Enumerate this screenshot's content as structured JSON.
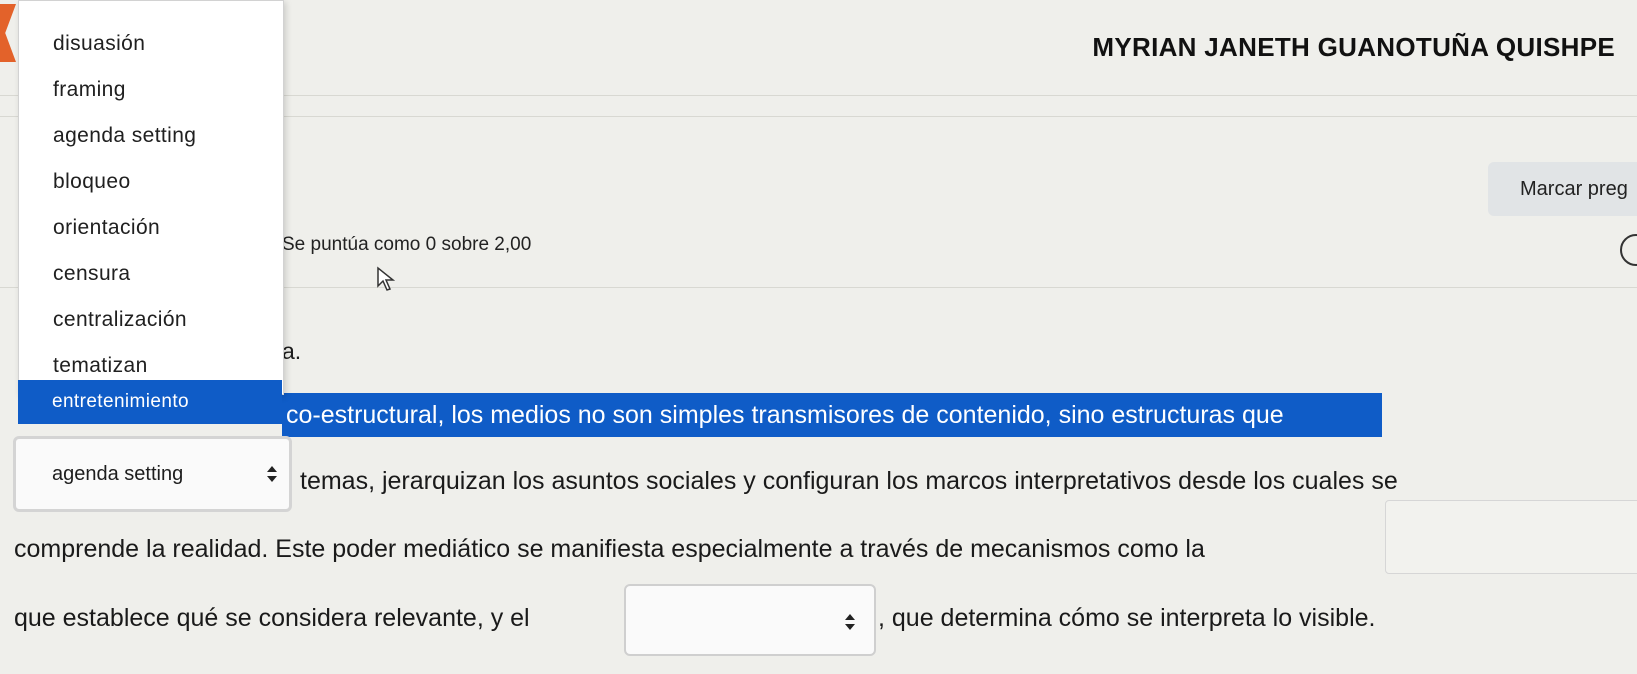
{
  "header": {
    "user_name": "MYRIAN JANETH GUANOTUÑA QUISHPE"
  },
  "question_info": {
    "flag_label": "Marcar preg",
    "score_text": "Se puntúa como 0 sobre 2,00"
  },
  "dropdown": {
    "options": [
      "disuasión",
      "framing",
      "agenda setting",
      "bloqueo",
      "orientación",
      "censura",
      "centralización",
      "tematizan",
      "entretenimiento"
    ]
  },
  "selects": {
    "first_value": "agenda setting",
    "second_value": "",
    "third_value": ""
  },
  "paragraph": {
    "fragment_a": "a.",
    "line_1": "co-estructural, los medios no son simples transmisores de contenido, sino estructuras que",
    "line_2": "temas, jerarquizan los asuntos sociales y configuran los marcos interpretativos desde los cuales se",
    "line_3": "comprende la realidad. Este poder mediático se manifiesta especialmente a través de mecanismos como la",
    "line_4a": "que establece qué se considera relevante, y el",
    "line_4b": ", que determina cómo se interpreta lo visible."
  },
  "colors": {
    "highlight": "#0f5cc7",
    "nav_accent": "#e3622a",
    "page_bg": "#efefeb"
  }
}
